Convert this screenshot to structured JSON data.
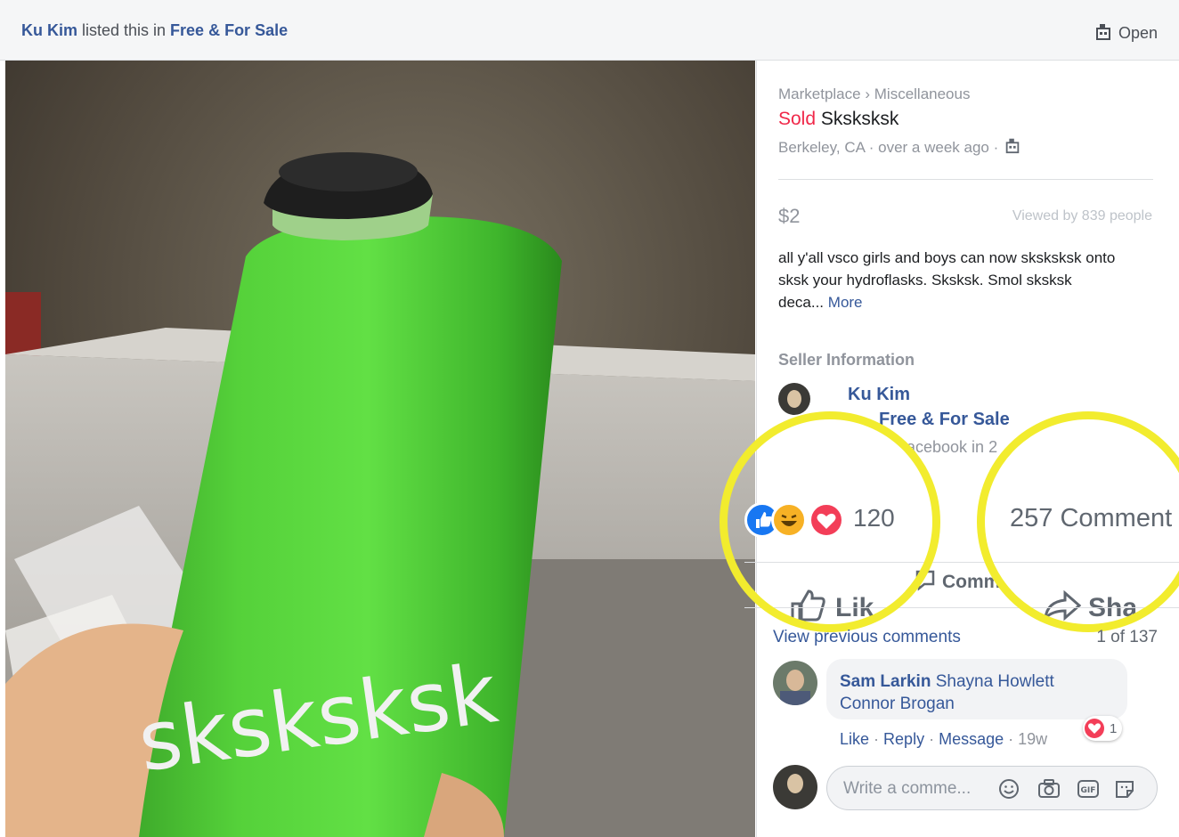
{
  "topbar": {
    "seller_name": "Ku Kim",
    "listed_text": " listed this in ",
    "group_name": "Free & For Sale",
    "open_label": "Open",
    "open_icon": "building-icon"
  },
  "listing": {
    "breadcrumb_root": "Marketplace",
    "breadcrumb_sep": "›",
    "breadcrumb_category": "Miscellaneous",
    "status": "Sold",
    "title": "Sksksksk",
    "location": "Berkeley, CA · over a week ago ·",
    "price": "$2",
    "views": "Viewed by 839 people",
    "description_line1": "all y'all vsco girls and boys can now sksksksk onto",
    "description_line2": "sksk your hydroflasks. Sksksk. Smol sksksk",
    "description_line3": "deca...",
    "more_label": "More",
    "photo_text": "sksksksk",
    "status_color": "#f02849"
  },
  "seller": {
    "heading": "Seller Information",
    "name": "Ku Kim",
    "group": "Free & For Sale",
    "joined": "acebook in 2"
  },
  "engagement": {
    "reaction_count": "120",
    "comments_count": "257 Comment",
    "reactions": [
      "like-icon",
      "haha-icon",
      "love-icon"
    ],
    "like_label": "Lik",
    "comment_label": "Comm",
    "share_label": "Sha",
    "highlight_color": "#f2ec2e"
  },
  "comments": {
    "view_previous": "View previous comments",
    "counter": "1 of 137",
    "items": [
      {
        "author": "Sam Larkin",
        "text_line1": " Shayna Howlett",
        "text_line2": "Connor Brogan",
        "like": "Like",
        "reply": "Reply",
        "message": "Message",
        "time": "19w",
        "reaction_count": "1"
      }
    ],
    "input_placeholder": "Write a comme..."
  }
}
